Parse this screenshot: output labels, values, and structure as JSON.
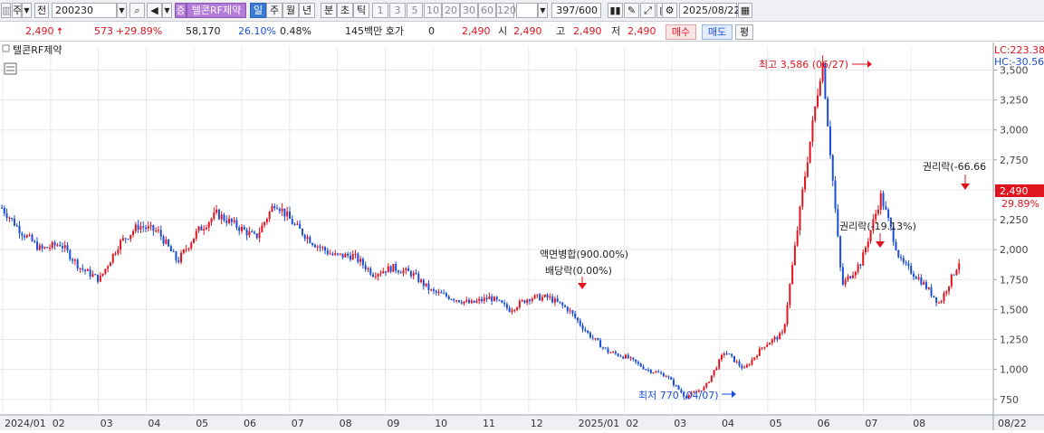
{
  "toolbar": {
    "period_label": "주",
    "prev_label": "전",
    "code": "200230",
    "exchange_badge": "증",
    "stock_name": "텔콘RF제약",
    "period_tabs": [
      "일",
      "주",
      "월",
      "년",
      "분",
      "초",
      "틱"
    ],
    "intervals": [
      "1",
      "3",
      "5",
      "10",
      "20",
      "30",
      "60",
      "120"
    ],
    "count": "397/600",
    "date": "2025/08/22"
  },
  "quote": {
    "price": "2,490",
    "change": "573",
    "change_pct": "+29.89%",
    "volume": "58,170",
    "turnover_pct": "26.10%",
    "vol_pct": "0.48%",
    "amount_label": "145백만 호가",
    "hoga": "0",
    "hoga_price": "2,490",
    "open_label": "시",
    "open": "2,490",
    "high_label": "고",
    "high": "2,490",
    "low_label": "저",
    "low": "2,490",
    "buy_label": "매수",
    "sell_label": "매도",
    "flat_label": "평"
  },
  "chart": {
    "legend": "텔콘RF제약",
    "lc_label": "LC:223.38",
    "hc_label": "HC:-30.56",
    "last_price_tag": "2,490",
    "last_change_tag": "29.89%",
    "max_label": "최고 3,586 (06/27)",
    "min_label": "최저 770 (04/07)",
    "annotations": [
      "액면병합(900.00%)",
      "배당락(0.00%)",
      "권리락(-19.13%)",
      "권리락(-66.66"
    ],
    "colors": {
      "up": "#e0141e",
      "down": "#1a4ed8",
      "axis_bg": "#eef0f4"
    }
  },
  "chart_data": {
    "type": "candlestick",
    "ylim": [
      650,
      3700
    ],
    "y_ticks": [
      "750",
      "1,000",
      "1,250",
      "1,500",
      "1,750",
      "2,000",
      "2,250",
      "2,500",
      "2,750",
      "3,000",
      "3,250",
      "3,500"
    ],
    "x_ticks": [
      "2024/01",
      "02",
      "03",
      "04",
      "05",
      "06",
      "07",
      "08",
      "09",
      "10",
      "11",
      "12",
      "2025/01",
      "02",
      "03",
      "04",
      "05",
      "06",
      "07",
      "08",
      "08/22"
    ],
    "close_path": [
      [
        "2024/01",
        2350
      ],
      [
        "2024/01",
        2150
      ],
      [
        "02",
        2000
      ],
      [
        "02",
        2050
      ],
      [
        "03",
        1850
      ],
      [
        "03",
        1750
      ],
      [
        "03",
        2050
      ],
      [
        "04",
        2200
      ],
      [
        "04",
        2150
      ],
      [
        "04",
        1900
      ],
      [
        "05",
        2150
      ],
      [
        "05",
        2300
      ],
      [
        "05",
        2200
      ],
      [
        "06",
        2100
      ],
      [
        "06",
        2400
      ],
      [
        "06",
        2200
      ],
      [
        "07",
        2050
      ],
      [
        "07",
        1950
      ],
      [
        "08",
        1950
      ],
      [
        "08",
        1800
      ],
      [
        "09",
        1850
      ],
      [
        "09",
        1800
      ],
      [
        "10",
        1650
      ],
      [
        "10",
        1600
      ],
      [
        "11",
        1550
      ],
      [
        "11",
        1600
      ],
      [
        "12",
        1500
      ],
      [
        "12",
        1600
      ],
      [
        "12",
        1600
      ],
      [
        "2025/01",
        1500
      ],
      [
        "2025/01",
        1300
      ],
      [
        "02",
        1150
      ],
      [
        "02",
        1100
      ],
      [
        "03",
        1000
      ],
      [
        "03",
        950
      ],
      [
        "04",
        770
      ],
      [
        "04",
        850
      ],
      [
        "05",
        1150
      ],
      [
        "05",
        1000
      ],
      [
        "06",
        1200
      ],
      [
        "06",
        1300
      ],
      [
        "06",
        2500
      ],
      [
        "06",
        3586
      ],
      [
        "07",
        1700
      ],
      [
        "07",
        1900
      ],
      [
        "07",
        2450
      ],
      [
        "07",
        1900
      ],
      [
        "08",
        1750
      ],
      [
        "08",
        1550
      ],
      [
        "08",
        1900
      ]
    ]
  }
}
